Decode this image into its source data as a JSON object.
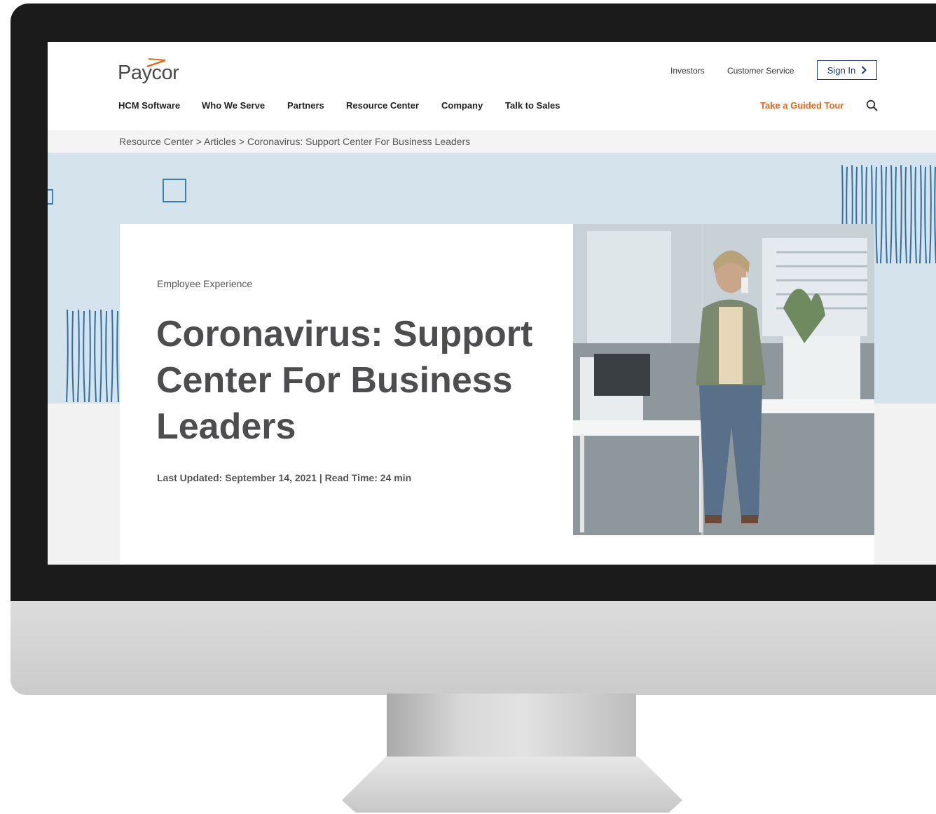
{
  "brand": {
    "name": "Paycor",
    "accent_color": "#e3671b",
    "navy": "#1f3b63"
  },
  "utility_nav": [
    {
      "label": "Investors"
    },
    {
      "label": "Customer Service"
    }
  ],
  "sign_in": {
    "label": "Sign In",
    "icon": "chevron-right-icon"
  },
  "main_nav": [
    {
      "label": "HCM Software"
    },
    {
      "label": "Who We Serve"
    },
    {
      "label": "Partners"
    },
    {
      "label": "Resource Center"
    },
    {
      "label": "Company"
    },
    {
      "label": "Talk to Sales"
    }
  ],
  "guided_tour": {
    "label": "Take a Guided Tour"
  },
  "search": {
    "icon": "search-icon"
  },
  "breadcrumb": {
    "text": "Resource Center > Articles > Coronavirus: Support Center For Business Leaders"
  },
  "article": {
    "category": "Employee Experience",
    "title": "Coronavirus: Support Center For Business Leaders",
    "meta": "Last Updated: September 14, 2021 | Read Time: 24 min"
  },
  "hero_image": {
    "subject": "woman-on-phone-in-office-photo"
  }
}
